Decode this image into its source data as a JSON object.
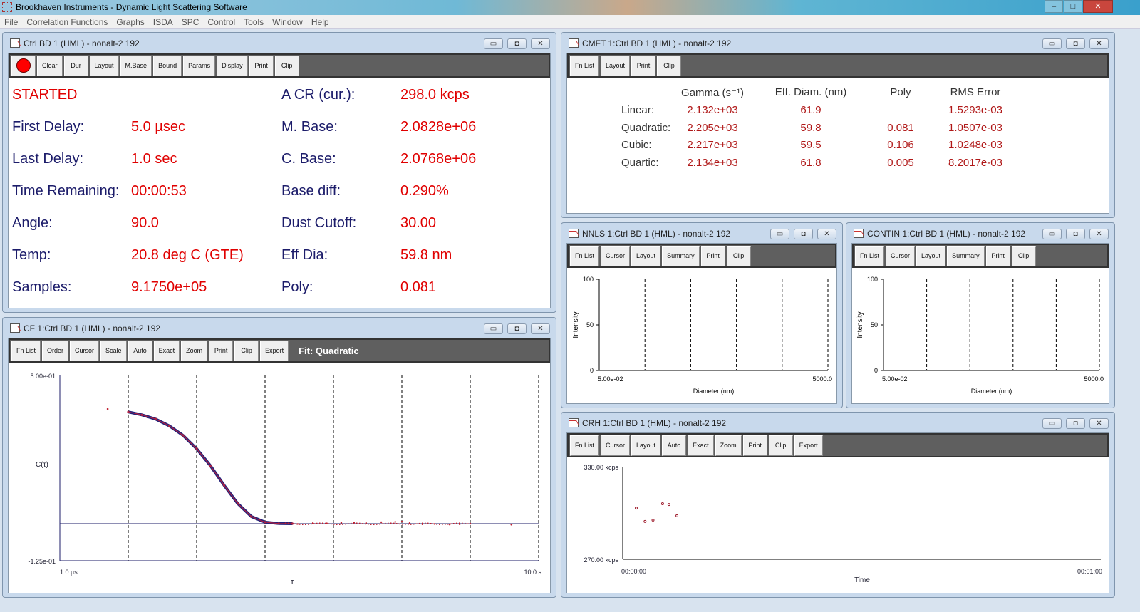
{
  "app": {
    "title": "Brookhaven Instruments - Dynamic Light Scattering Software",
    "controls": [
      "–",
      "□",
      "✕"
    ]
  },
  "menu": [
    "File",
    "Correlation Functions",
    "Graphs",
    "ISDA",
    "SPC",
    "Control",
    "Tools",
    "Window",
    "Help"
  ],
  "window_buttons": [
    "▭",
    "◘",
    "✕"
  ],
  "ctrl": {
    "title": "Ctrl BD 1 (HML) - nonalt-2 192",
    "toolbar": [
      "Clear",
      "Dur",
      "Layout",
      "M.Base",
      "Bound",
      "Params",
      "Display",
      "Print",
      "Clip"
    ],
    "status": "STARTED",
    "left": [
      {
        "label": "First Delay:",
        "value": "5.0 µsec"
      },
      {
        "label": "Last Delay:",
        "value": "1.0 sec"
      },
      {
        "label": "Time Remaining:",
        "value": "00:00:53"
      },
      {
        "label": "Angle:",
        "value": "90.0"
      },
      {
        "label": "Temp:",
        "value": "20.8 deg C (GTE)"
      },
      {
        "label": "Samples:",
        "value": "9.1750e+05"
      }
    ],
    "right": [
      {
        "label": "A CR (cur.):",
        "value": "298.0 kcps"
      },
      {
        "label": "M. Base:",
        "value": "2.0828e+06"
      },
      {
        "label": "C. Base:",
        "value": "2.0768e+06"
      },
      {
        "label": "Base diff:",
        "value": "0.290%"
      },
      {
        "label": "Dust Cutoff:",
        "value": "30.00"
      },
      {
        "label": "Eff Dia:",
        "value": "59.8 nm"
      },
      {
        "label": "Poly:",
        "value": "0.081"
      }
    ]
  },
  "cmft": {
    "title": "CMFT 1:Ctrl BD 1 (HML) - nonalt-2 192",
    "toolbar": [
      "Fn List",
      "Layout",
      "Print",
      "Clip"
    ],
    "headers": [
      "Gamma (s⁻¹)",
      "Eff. Diam. (nm)",
      "Poly",
      "RMS Error"
    ],
    "rows": [
      [
        "Linear:",
        "2.132e+03",
        "61.9",
        "",
        "1.5293e-03"
      ],
      [
        "Quadratic:",
        "2.205e+03",
        "59.8",
        "0.081",
        "1.0507e-03"
      ],
      [
        "Cubic:",
        "2.217e+03",
        "59.5",
        "0.106",
        "1.0248e-03"
      ],
      [
        "Quartic:",
        "2.134e+03",
        "61.8",
        "0.005",
        "8.2017e-03"
      ]
    ]
  },
  "nnls": {
    "title": "NNLS 1:Ctrl BD 1 (HML) - nonalt-2 192",
    "toolbar": [
      "Fn List",
      "Cursor",
      "Layout",
      "Summary",
      "Print",
      "Clip"
    ],
    "chart": {
      "ylabel": "Intensity",
      "xlabel": "Diameter (nm)",
      "yticks": [
        "100",
        "50",
        "0"
      ],
      "xmin": "5.00e-02",
      "xmax": "5000.0"
    }
  },
  "contin": {
    "title": "CONTIN 1:Ctrl BD 1 (HML) - nonalt-2 192",
    "toolbar": [
      "Fn List",
      "Cursor",
      "Layout",
      "Summary",
      "Print",
      "Clip"
    ],
    "chart": {
      "ylabel": "Intensity",
      "xlabel": "Diameter (nm)",
      "yticks": [
        "100",
        "50",
        "0"
      ],
      "xmin": "5.00e-02",
      "xmax": "5000.0"
    }
  },
  "cf": {
    "title": "CF 1:Ctrl BD 1 (HML) - nonalt-2 192",
    "toolbar": [
      "Fn List",
      "Order",
      "Cursor",
      "Scale",
      "Auto",
      "Exact",
      "Zoom",
      "Print",
      "Clip",
      "Export"
    ],
    "fit_label": "Fit: Quadratic"
  },
  "crh": {
    "title": "CRH 1:Ctrl BD 1 (HML) - nonalt-2 192",
    "toolbar": [
      "Fn List",
      "Cursor",
      "Layout",
      "Auto",
      "Exact",
      "Zoom",
      "Print",
      "Clip",
      "Export"
    ]
  },
  "chart_data": [
    {
      "type": "scatter",
      "name": "correlation-function",
      "ylabel": "C(τ)",
      "xlabel": "τ",
      "xscale": "log",
      "xlim": [
        1e-06,
        10
      ],
      "ylim": [
        -0.125,
        0.5
      ],
      "ytick_labels": [
        "5.00e-01",
        "-1.25e-01"
      ],
      "xtick_labels": [
        "1.0 µs",
        "10.0 s"
      ],
      "outlier": [
        [
          5e-06,
          0.387
        ],
        [
          4,
          -0.003
        ]
      ],
      "fit": [
        [
          1e-05,
          0.377
        ],
        [
          1.585e-05,
          0.367
        ],
        [
          2.512e-05,
          0.353
        ],
        [
          3.981e-05,
          0.33
        ],
        [
          6.31e-05,
          0.298
        ],
        [
          0.0001,
          0.253
        ],
        [
          0.0001585,
          0.196
        ],
        [
          0.0002512,
          0.13
        ],
        [
          0.0003981,
          0.068
        ],
        [
          0.000631,
          0.024
        ],
        [
          0.001,
          0.005
        ],
        [
          0.001585,
          0.0005
        ],
        [
          0.002512,
          0
        ]
      ],
      "baseline_noise": [
        [
          0.002,
          0.001
        ],
        [
          0.003,
          -0.001
        ],
        [
          0.005,
          0.002
        ],
        [
          0.008,
          0.001
        ],
        [
          0.013,
          0.003
        ],
        [
          0.02,
          0.004
        ],
        [
          0.03,
          0.002
        ],
        [
          0.05,
          0.005
        ],
        [
          0.08,
          0.006
        ],
        [
          0.1,
          0.007
        ],
        [
          0.13,
          0.002
        ],
        [
          0.2,
          -0.002
        ],
        [
          0.3,
          -0.001
        ],
        [
          0.5,
          -0.003
        ],
        [
          0.7,
          -0.002
        ],
        [
          1.0,
          0.0
        ]
      ]
    },
    {
      "type": "scatter",
      "name": "count-rate-history",
      "xlabel": "Time",
      "ylim": [
        270,
        330
      ],
      "xlim": [
        0,
        60
      ],
      "ytick_labels": [
        "330.00 kcps",
        "270.00 kcps"
      ],
      "xtick_labels": [
        "00:00:00",
        "00:01:00"
      ],
      "points": [
        [
          1.7,
          303.2
        ],
        [
          2.8,
          294.5
        ],
        [
          3.8,
          295.4
        ],
        [
          5.0,
          306.0
        ],
        [
          5.8,
          305.5
        ],
        [
          6.8,
          298.2
        ]
      ]
    }
  ]
}
